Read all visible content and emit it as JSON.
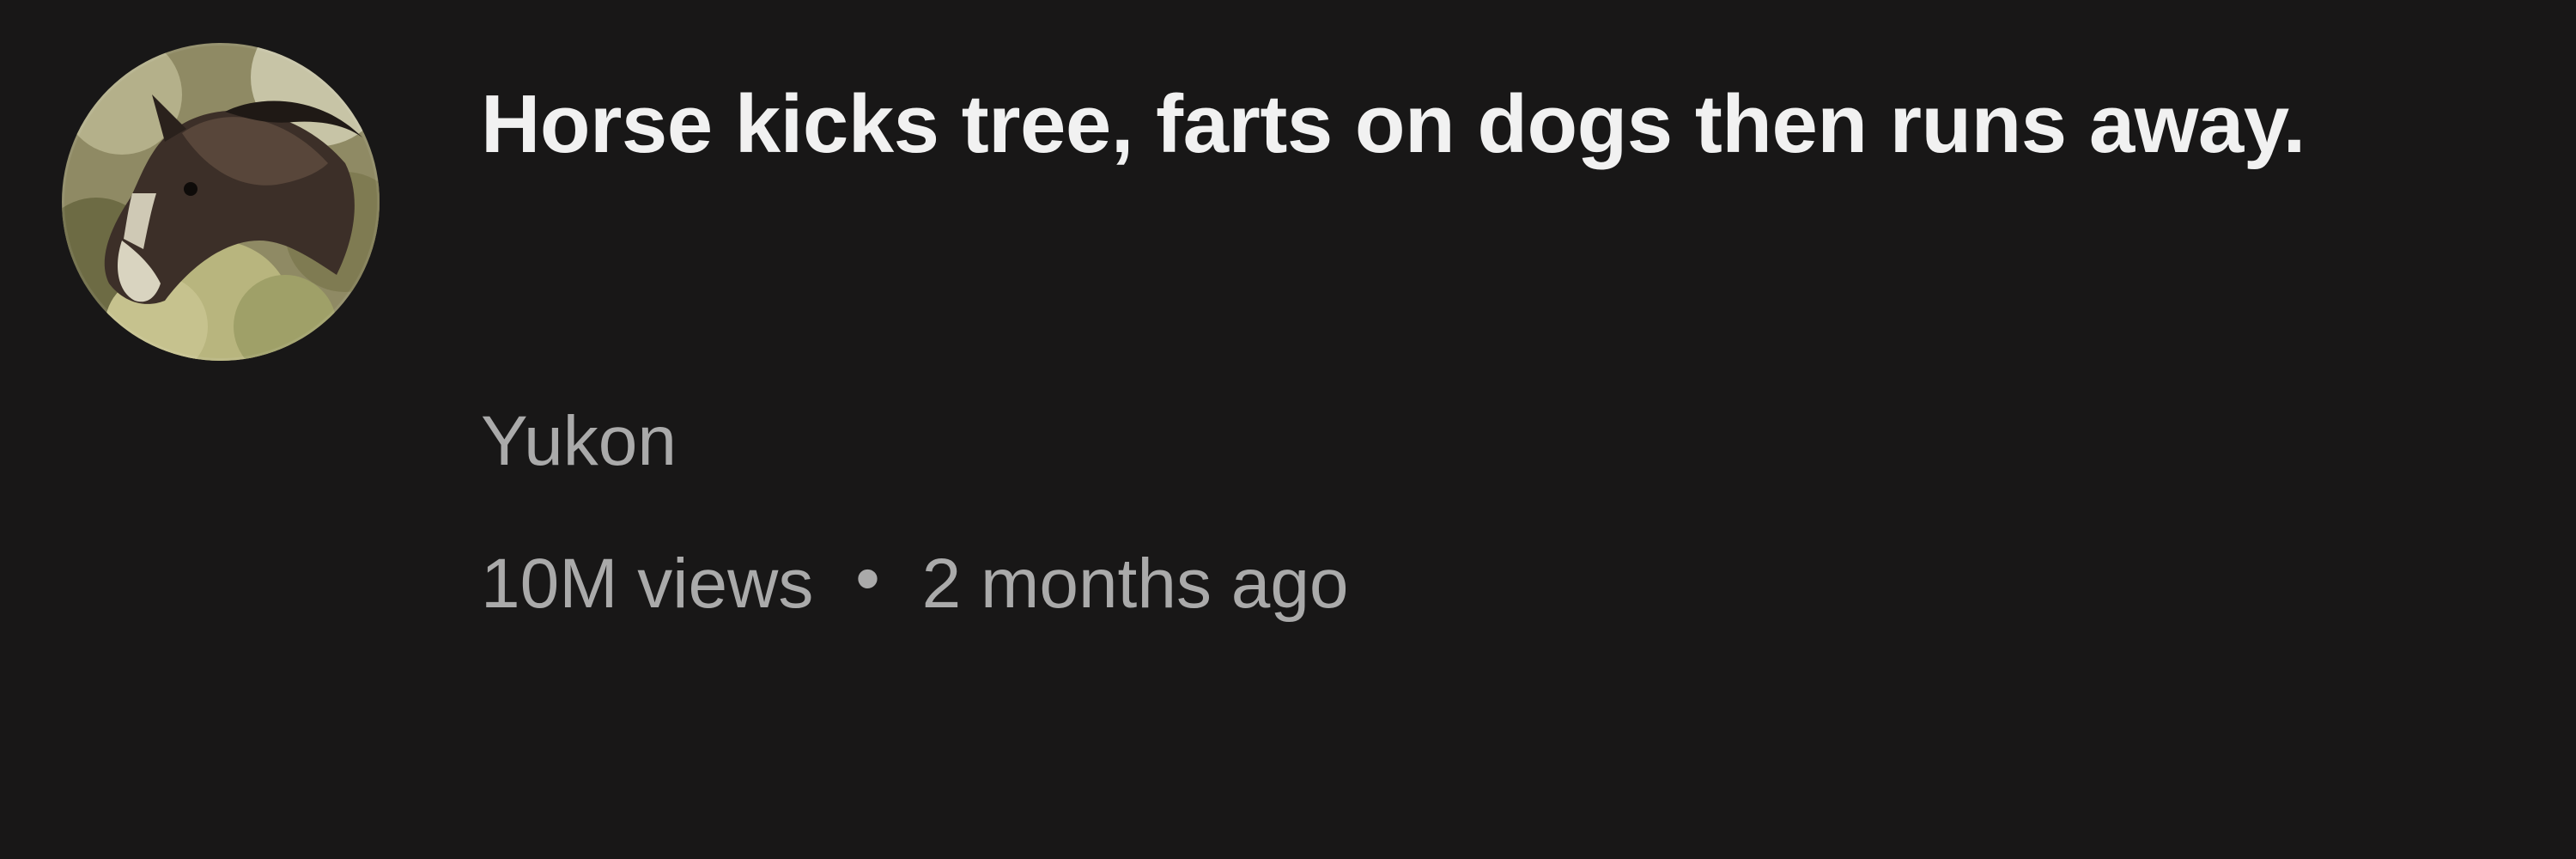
{
  "video": {
    "title": "Horse kicks tree, farts on dogs then runs away.",
    "channel": "Yukon",
    "views": "10M views",
    "separator": "•",
    "age": "2 months ago"
  },
  "avatar": {
    "icon": "horse-avatar-icon"
  },
  "colors": {
    "background": "#181717",
    "title": "#f1f1f1",
    "secondary_text": "#aaaaaa"
  }
}
